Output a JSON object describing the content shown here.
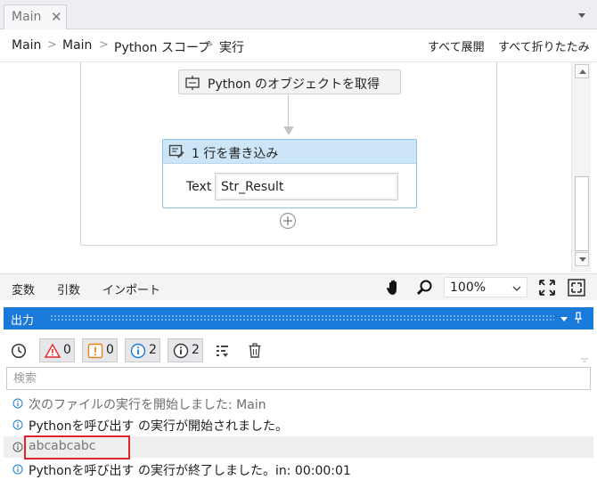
{
  "tab": {
    "title": "Main",
    "close": "✕"
  },
  "breadcrumb": {
    "items": [
      "Main",
      "Main",
      "Python スコープ",
      "実行"
    ],
    "separator": ">"
  },
  "breadcrumb_actions": {
    "expand_all": "すべて展開",
    "collapse_all": "すべて折りたたみ"
  },
  "workflow": {
    "get_object": {
      "title": "Python のオブジェクトを取得",
      "icon": "python-object-icon"
    },
    "write_line": {
      "title": "1 行を書き込み",
      "icon": "write-line-icon",
      "field_label": "Text",
      "field_value": "Str_Result"
    }
  },
  "designer_footer": {
    "tabs": [
      "変数",
      "引数",
      "インポート"
    ],
    "zoom": "100%"
  },
  "output": {
    "title": "出力",
    "filters": {
      "errors": "0",
      "warnings": "0",
      "info": "2",
      "trace": "2"
    },
    "search_placeholder": "検索",
    "logs": [
      {
        "text": "次のファイルの実行を開始しました: Main",
        "color": "#6d6d6d"
      },
      {
        "text": "Pythonを呼び出す の実行が開始されました。",
        "color": "#1e1e1e"
      },
      {
        "text": "abcabcabc",
        "color": "#7a7a7a"
      },
      {
        "text": "Pythonを呼び出す の実行が終了しました。in: 00:00:01",
        "color": "#1e1e1e"
      }
    ]
  },
  "colors": {
    "accent": "#1a7ad9",
    "highlight": "#e0242a",
    "error": "#e0242a",
    "warning": "#e8821a",
    "info": "#1a7ad9"
  }
}
